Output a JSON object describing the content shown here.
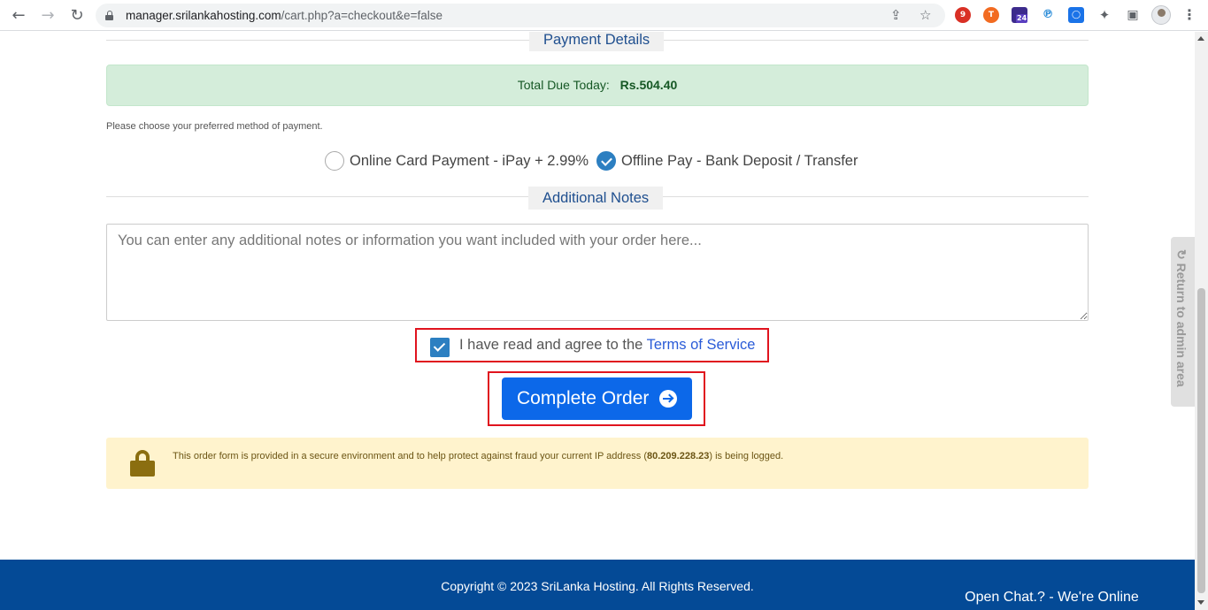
{
  "browser": {
    "url_host": "manager.srilankahosting.com",
    "url_path": "/cart.php?a=checkout&e=false",
    "extension_badge": "24"
  },
  "payment": {
    "section_title": "Payment Details",
    "total_label": "Total Due Today:",
    "total_amount": "Rs.504.40",
    "choose_text": "Please choose your preferred method of payment.",
    "options": [
      {
        "label": "Online Card Payment - iPay + 2.99%",
        "selected": false
      },
      {
        "label": "Offline Pay - Bank Deposit / Transfer",
        "selected": true
      }
    ]
  },
  "notes": {
    "section_title": "Additional Notes",
    "placeholder": "You can enter any additional notes or information you want included with your order here..."
  },
  "tos": {
    "checked": true,
    "text": "I have read and agree to the ",
    "link": "Terms of Service"
  },
  "order": {
    "button_label": "Complete Order"
  },
  "secure": {
    "text_before": "This order form is provided in a secure environment and to help protect against fraud your current IP address (",
    "ip": "80.209.228.23",
    "text_after": ") is being logged."
  },
  "footer": {
    "copyright": "Copyright © 2023 SriLanka Hosting. All Rights Reserved.",
    "chat_label": "Open Chat.? - We're Online"
  },
  "admin": {
    "return_label": "Return to admin area"
  },
  "colors": {
    "primary_button": "#0c68e9",
    "footer_bg": "#044a96",
    "highlight_border": "#e0141e",
    "success_bg": "#d4edda",
    "warning_bg": "#fff3cd"
  }
}
